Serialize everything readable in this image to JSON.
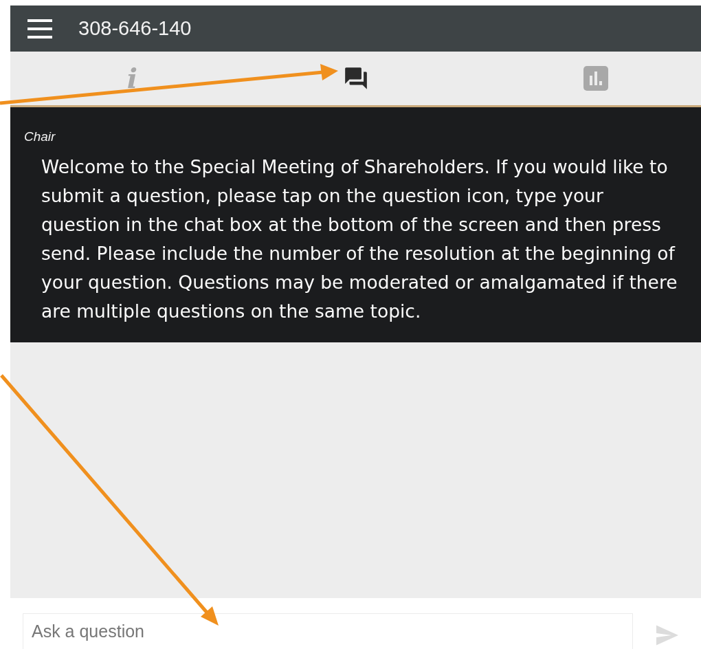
{
  "header": {
    "title": "308-646-140"
  },
  "tabs": [
    {
      "kind": "info",
      "label": "i",
      "selected": false
    },
    {
      "kind": "chat",
      "selected": true
    },
    {
      "kind": "poll",
      "selected": false
    }
  ],
  "message": {
    "sender": "Chair",
    "text": "Welcome to the Special Meeting of Shareholders. If you would like to submit a question, please tap on the question icon, type your question in the chat box at the bottom of the screen and then press send. Please include the number of the resolution at the beginning of your question. Questions may be moderated or amalgamated if there are multiple questions on the same topic."
  },
  "composer": {
    "placeholder": "Ask a question"
  }
}
